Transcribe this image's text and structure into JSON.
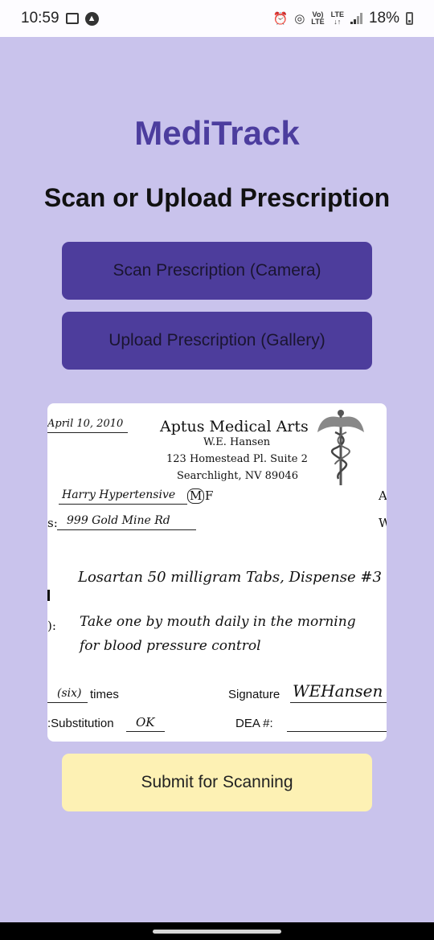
{
  "status_bar": {
    "time": "10:59",
    "network_top": "Vo)",
    "network_bottom": "LTE",
    "lte_top": "LTE",
    "lte_arrows": "↓↑",
    "battery": "18%"
  },
  "app": {
    "title": "MediTrack",
    "heading": "Scan or Upload Prescription"
  },
  "buttons": {
    "scan": "Scan Prescription (Camera)",
    "upload": "Upload Prescription (Gallery)",
    "submit": "Submit for Scanning"
  },
  "prescription": {
    "date": "April 10, 2010",
    "practice": "Aptus Medical Arts",
    "doctor": "W.E. Hansen",
    "address1": "123 Homestead Pl. Suite 2",
    "address2": "Searchlight, NV 89046",
    "patient": "Harry Hypertensive",
    "sex_m": "M",
    "sex_f": "F",
    "right_a": "A",
    "address_prefix": "s:",
    "patient_address": "999 Gold Mine Rd",
    "right_w": "W",
    "medication": "Losartan 50 milligram Tabs, Dispense #3",
    "sig_prefix": "):",
    "sig_line1": "Take one by mouth daily in the morning",
    "sig_line2": "for blood pressure control",
    "refill_count": "(six)",
    "times": "times",
    "signature_label": "Signature",
    "signature": "WEHansen",
    "substitution_label": ":Substitution",
    "substitution_value": "OK",
    "dea_label": "DEA #:"
  }
}
